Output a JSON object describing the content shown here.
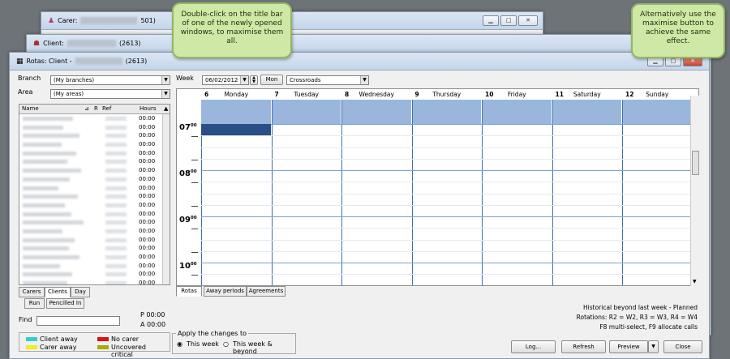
{
  "windows": {
    "carer_title": "Carer:",
    "carer_id": "501)",
    "client_title": "Client:",
    "client_id": "(2613)",
    "rotas_title": "Rotas: Client -",
    "rotas_id": "(2613)"
  },
  "callouts": {
    "left": "Double-click on the title bar of one of the newly opened windows, to maximise them all.",
    "right": "Alternatively use the maximise button to achieve the same effect."
  },
  "filters": {
    "branch_label": "Branch",
    "branch_value": "(My branches)",
    "area_label": "Area",
    "area_value": "(My areas)"
  },
  "list": {
    "columns": [
      "Name",
      "R",
      "Ref",
      "Hours"
    ],
    "hours": [
      "00:00",
      "00:00",
      "00:00",
      "00:00",
      "00:00",
      "00:00",
      "00:00",
      "00:00",
      "00:00",
      "00:00",
      "00:00",
      "00:00",
      "00:00",
      "00:00",
      "00:00",
      "00:00",
      "00:00",
      "00:00",
      "00:00",
      "00:00"
    ]
  },
  "left_tabs": {
    "carers": "Carers",
    "clients": "Clients",
    "day": "Day",
    "run": "Run",
    "pencilled": "Pencilled In"
  },
  "find": {
    "label": "Find",
    "p_time": "P 00:00",
    "a_time": "A 00:00"
  },
  "legend": [
    {
      "label": "Client away",
      "color": "#33ccdd"
    },
    {
      "label": "No carer",
      "color": "#dd1111"
    },
    {
      "label": "Carer away",
      "color": "#eeee22"
    },
    {
      "label": "Uncovered critical",
      "color": "#aaaa11"
    }
  ],
  "week": {
    "label": "Week",
    "date": "06/02/2012",
    "day_button": "Mon",
    "location": "Crossroads"
  },
  "days": [
    {
      "num": "6",
      "name": "Monday"
    },
    {
      "num": "7",
      "name": "Tuesday"
    },
    {
      "num": "8",
      "name": "Wednesday"
    },
    {
      "num": "9",
      "name": "Thursday"
    },
    {
      "num": "10",
      "name": "Friday"
    },
    {
      "num": "11",
      "name": "Saturday"
    },
    {
      "num": "12",
      "name": "Sunday"
    }
  ],
  "hours": [
    {
      "h": "07",
      "m": "00"
    },
    {
      "h": "08",
      "m": "00"
    },
    {
      "h": "09",
      "m": "00"
    },
    {
      "h": "10",
      "m": "00"
    }
  ],
  "sched_tabs": {
    "rotas": "Rotas",
    "away": "Away periods",
    "agreements": "Agreements"
  },
  "apply": {
    "legend": "Apply the changes to",
    "this_week": "This week",
    "this_week_beyond": "This week & beyond"
  },
  "status_lines": [
    "Historical beyond last week - Planned",
    "Rotations: R2 = W2, R3 = W3, R4 = W4",
    "F8 multi-select, F9 allocate calls"
  ],
  "buttons": {
    "log": "Log...",
    "refresh": "Refresh",
    "preview": "Preview",
    "close": "Close"
  }
}
